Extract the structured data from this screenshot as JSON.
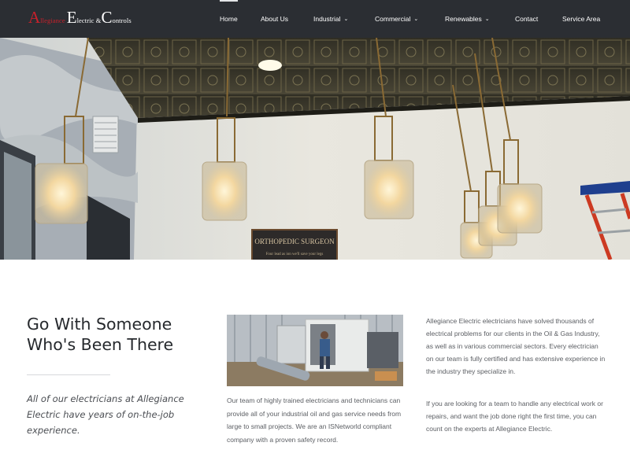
{
  "brand": {
    "logo_text": "Allegiance Electric & Controls",
    "logo_parts": {
      "a_big": "A",
      "a_small": "llegiance",
      "e_big": "E",
      "e_small": "lectric & ",
      "c_big": "C",
      "c_small": "ontrols"
    },
    "colors": {
      "red": "#c8202b",
      "header_bg": "#2b2e33"
    }
  },
  "nav": {
    "items": [
      {
        "label": "Home",
        "active": true,
        "has_dropdown": false
      },
      {
        "label": "About Us",
        "active": false,
        "has_dropdown": false
      },
      {
        "label": "Industrial",
        "active": false,
        "has_dropdown": true
      },
      {
        "label": "Commercial",
        "active": false,
        "has_dropdown": true
      },
      {
        "label": "Renewables",
        "active": false,
        "has_dropdown": true
      },
      {
        "label": "Contact",
        "active": false,
        "has_dropdown": false
      },
      {
        "label": "Service Area",
        "active": false,
        "has_dropdown": false
      }
    ],
    "dropdown_icon": "chevron-down-icon"
  },
  "hero": {
    "sign_line1": "ORTHOPEDIC SURGEON",
    "sign_line2": "Four lead as ion     we'll save your legs"
  },
  "main": {
    "heading": "Go With Someone Who's Been There",
    "quote": "All of our electricians at Allegiance Electric have years of on-the-job experience.",
    "middle_text": "Our team of highly trained electricians and technicians can provide all of your industrial oil and gas service needs from large to small projects. We are an ISNetworld compliant company with a proven safety record.",
    "right_text_1": "Allegiance Electric electricians have solved thousands of electrical problems for our clients in the Oil & Gas Industry, as well as in various commercial sectors. Every electrician on our team is fully certified and has extensive experience in the industry they specialize in.",
    "right_text_2": "If you are looking for a team to handle any electrical work or repairs, and want the job done right the first time, you can count on the experts at Allegiance Electric."
  }
}
